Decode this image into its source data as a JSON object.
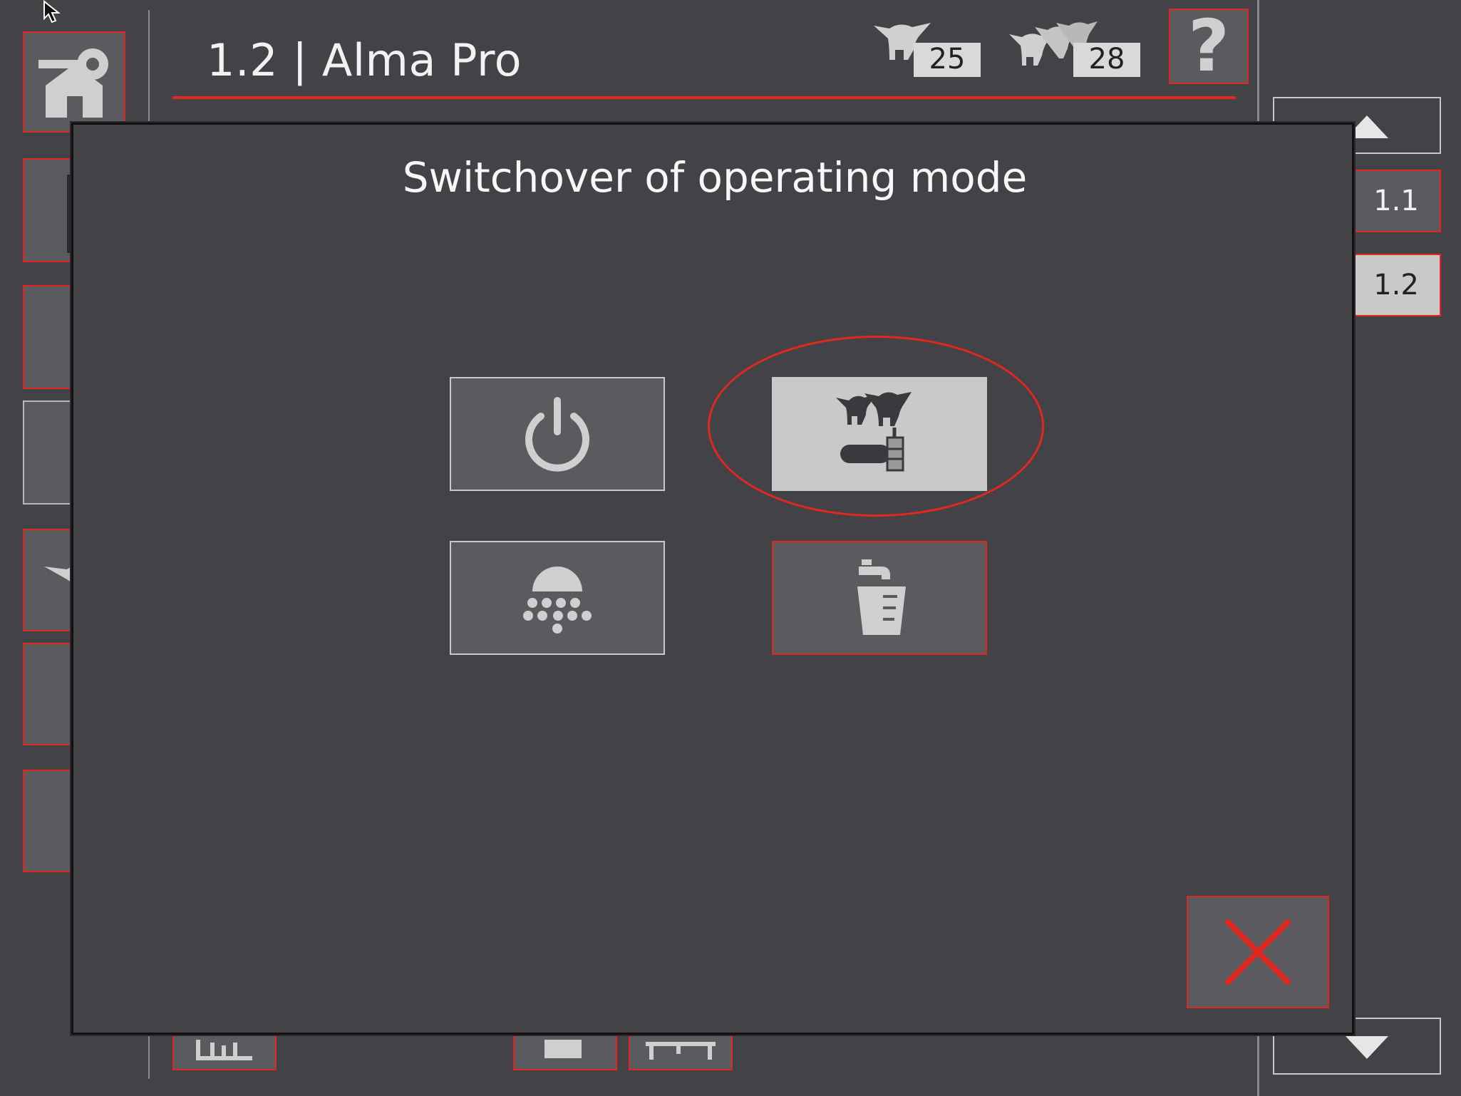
{
  "header": {
    "title": "1.2 | Alma Pro",
    "animal_count_single": "25",
    "animal_count_group": "28",
    "help_label": "?"
  },
  "pages": [
    "1.1",
    "1.2"
  ],
  "modal": {
    "title": "Switchover of operating mode",
    "modes": [
      {
        "name": "power-off",
        "icon": "power-icon",
        "selected": false
      },
      {
        "name": "feeding",
        "icon": "calf-feeding-icon",
        "selected": true
      },
      {
        "name": "cleaning",
        "icon": "shower-cleaning-icon",
        "selected": false
      },
      {
        "name": "water-tank",
        "icon": "tap-bucket-icon",
        "selected": false
      }
    ],
    "close_icon": "close-x-icon"
  },
  "sidebar_icons": [
    "key-house-icon",
    "device-icon",
    "folder-icon",
    "document-eye-icon",
    "calf-icon",
    "calf-icon",
    "gear-icon"
  ],
  "colors": {
    "accent": "#e0281f",
    "background": "#434247",
    "tile": "#5b5a5f",
    "active": "#c9c9c9"
  }
}
